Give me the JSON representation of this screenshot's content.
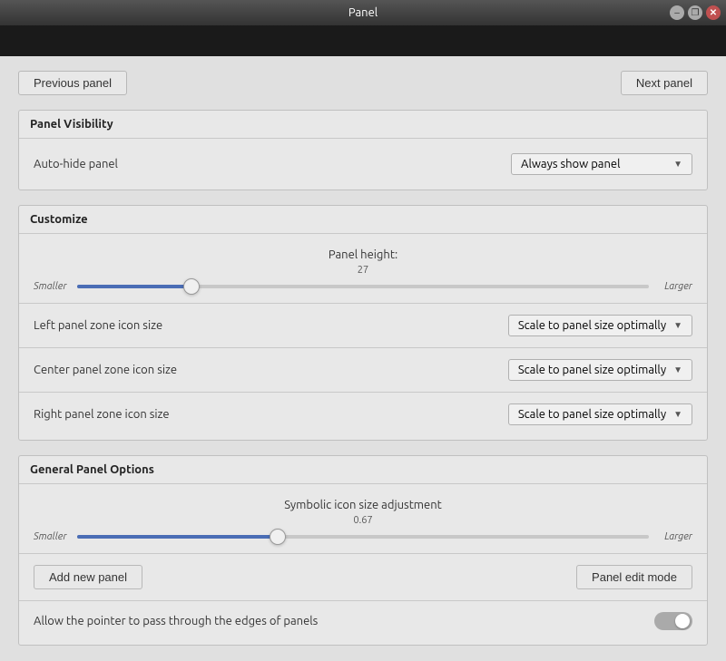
{
  "window": {
    "title": "Panel"
  },
  "titlebar": {
    "minimize_label": "–",
    "restore_label": "❐",
    "close_label": "✕"
  },
  "nav": {
    "previous_label": "Previous panel",
    "next_label": "Next panel"
  },
  "panel_visibility": {
    "section_title": "Panel Visibility",
    "row_label": "Auto-hide panel",
    "dropdown_value": "Always show panel",
    "dropdown_arrow": "▼"
  },
  "customize": {
    "section_title": "Customize",
    "slider_title": "Panel height:",
    "slider_value": "27",
    "slider_min_label": "Smaller",
    "slider_max_label": "Larger",
    "slider_percent": 20,
    "rows": [
      {
        "label": "Left panel zone icon size",
        "dropdown": "Scale to panel size optimally",
        "arrow": "▼"
      },
      {
        "label": "Center panel zone icon size",
        "dropdown": "Scale to panel size optimally",
        "arrow": "▼"
      },
      {
        "label": "Right panel zone icon size",
        "dropdown": "Scale to panel size optimally",
        "arrow": "▼"
      }
    ]
  },
  "general": {
    "section_title": "General Panel Options",
    "slider_title": "Symbolic icon size adjustment",
    "slider_value": "0.67",
    "slider_min_label": "Smaller",
    "slider_max_label": "Larger",
    "slider_percent": 35,
    "add_panel_label": "Add new panel",
    "edit_mode_label": "Panel edit mode",
    "toggle_label": "Allow the pointer to pass through the edges of panels",
    "toggle_x": "✕"
  }
}
